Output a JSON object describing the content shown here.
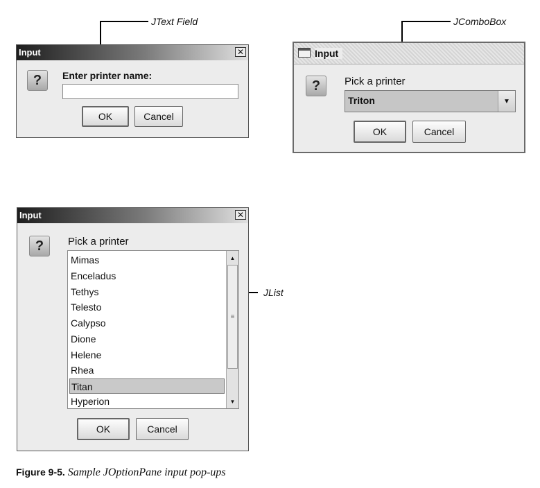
{
  "annotations": {
    "textfield": "JText Field",
    "combobox": "JComboBox",
    "list": "JList"
  },
  "dialog1": {
    "title": "Input",
    "close_glyph": "✕",
    "icon_glyph": "?",
    "prompt": "Enter printer name:",
    "input_value": "",
    "ok_label": "OK",
    "cancel_label": "Cancel"
  },
  "dialog2": {
    "title": "Input",
    "icon_glyph": "?",
    "prompt": "Pick a printer",
    "selected": "Triton",
    "ok_label": "OK",
    "cancel_label": "Cancel"
  },
  "dialog3": {
    "title": "Input",
    "close_glyph": "✕",
    "icon_glyph": "?",
    "prompt": "Pick a printer",
    "items": [
      "Mimas",
      "Enceladus",
      "Tethys",
      "Telesto",
      "Calypso",
      "Dione",
      "Helene",
      "Rhea",
      "Titan",
      "Hyperion"
    ],
    "selected_item": "Titan",
    "ok_label": "OK",
    "cancel_label": "Cancel"
  },
  "caption": {
    "label": "Figure 9-5.",
    "text": "Sample JOptionPane input pop-ups"
  }
}
